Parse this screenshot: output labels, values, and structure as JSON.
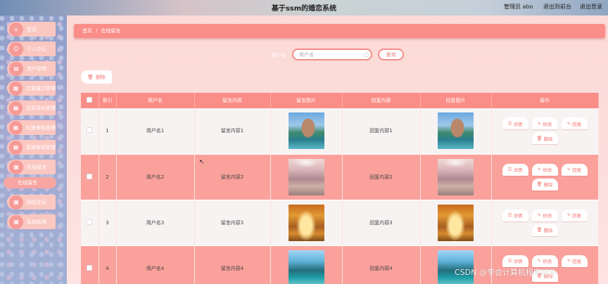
{
  "header": {
    "title": "基于ssm的婚恋系统",
    "admin": "管理员 abo",
    "exit_to_front": "退出到前台",
    "logout": "退出登录"
  },
  "sidebar": {
    "items": [
      {
        "label": "首页",
        "icon": "home-icon"
      },
      {
        "label": "个人中心",
        "icon": "person-icon"
      },
      {
        "label": "用户管理",
        "icon": "user-icon"
      },
      {
        "label": "恋爱展示管理",
        "icon": "grid-icon"
      },
      {
        "label": "会员评价管理",
        "icon": "grid-icon"
      },
      {
        "label": "红娘审核管理",
        "icon": "grid-icon"
      },
      {
        "label": "系统审核管理",
        "icon": "grid-icon"
      },
      {
        "label": "在线留言",
        "icon": "grid-icon"
      },
      {
        "label": "网站论坛",
        "icon": "grid-icon"
      },
      {
        "label": "系统管理",
        "icon": "grid-icon"
      }
    ],
    "active_sub": "在线留言"
  },
  "breadcrumb": {
    "home": "首页",
    "sep": "/",
    "current": "在线留言"
  },
  "search": {
    "label": "用户名",
    "placeholder": "用户名",
    "button": "查询"
  },
  "toolbar": {
    "delete_label": "删除"
  },
  "table": {
    "headers": [
      "索引",
      "用户名",
      "留言内容",
      "留言图片",
      "回复内容",
      "回复图片",
      "操作"
    ],
    "rows": [
      {
        "index": "1",
        "username": "用户名1",
        "content": "留言内容1",
        "reply": "回复内容1",
        "img": "lake"
      },
      {
        "index": "2",
        "username": "用户名2",
        "content": "留言内容2",
        "reply": "回复内容2",
        "img": "path"
      },
      {
        "index": "3",
        "username": "用户名3",
        "content": "留言内容3",
        "reply": "回复内容3",
        "img": "autumn"
      },
      {
        "index": "4",
        "username": "用户名4",
        "content": "留言内容4",
        "reply": "回复内容4",
        "img": "river"
      }
    ],
    "ops": {
      "detail": "详情",
      "edit": "修改",
      "reply": "回复",
      "delete": "删除"
    }
  },
  "watermark": "CSDN @李会计算机程序设计",
  "colors": {
    "accent": "#fa8d87",
    "row_even": "#fba19c",
    "row_odd": "#f7f3f3"
  }
}
